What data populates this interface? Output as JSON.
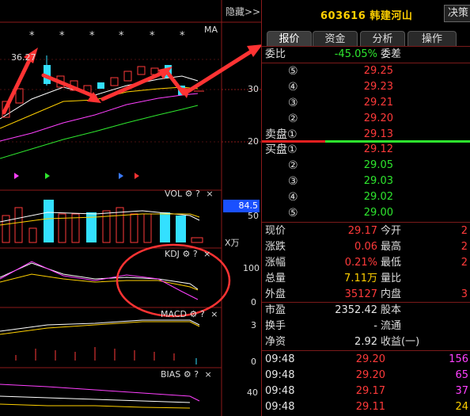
{
  "header": {
    "hide_label": "隐藏>>",
    "stock_code": "603616",
    "stock_name": "韩建河山",
    "decision_label": "决策"
  },
  "tabs": [
    "报价",
    "资金",
    "分析",
    "操作"
  ],
  "commission": {
    "label": "委比",
    "ratio": "-45.05%",
    "diff_label": "委差"
  },
  "asks": [
    {
      "num": "⑤",
      "price": "29.25"
    },
    {
      "num": "④",
      "price": "29.23"
    },
    {
      "num": "③",
      "price": "29.21"
    },
    {
      "num": "②",
      "price": "29.20"
    },
    {
      "num": "卖盘①",
      "price": "29.13"
    }
  ],
  "bids": [
    {
      "num": "买盘①",
      "price": "29.12"
    },
    {
      "num": "②",
      "price": "29.05"
    },
    {
      "num": "③",
      "price": "29.03"
    },
    {
      "num": "④",
      "price": "29.02"
    },
    {
      "num": "⑤",
      "price": "29.00"
    }
  ],
  "quote": {
    "rows": [
      {
        "l1": "现价",
        "v1": "29.17",
        "c1": "red",
        "l2": "今开",
        "v2": "2"
      },
      {
        "l1": "涨跌",
        "v1": "0.06",
        "c1": "red",
        "l2": "最高",
        "v2": "2"
      },
      {
        "l1": "涨幅",
        "v1": "0.21%",
        "c1": "red",
        "l2": "最低",
        "v2": "2"
      },
      {
        "l1": "总量",
        "v1": "7.11万",
        "c1": "yellow",
        "l2": "量比",
        "v2": ""
      },
      {
        "l1": "外盘",
        "v1": "35127",
        "c1": "red",
        "l2": "内盘",
        "v2": "3"
      }
    ]
  },
  "fundamentals": [
    {
      "l1": "市盈",
      "v1": "2352.42",
      "l2": "股本"
    },
    {
      "l1": "换手",
      "v1": "-",
      "l2": "流通"
    },
    {
      "l1": "净资",
      "v1": "2.92",
      "l2": "收益(一)"
    }
  ],
  "ticks": [
    {
      "time": "09:48",
      "price": "29.20",
      "vol": "156",
      "vc": "#ff40ff"
    },
    {
      "time": "09:48",
      "price": "29.20",
      "vol": "65",
      "vc": "#ff40ff"
    },
    {
      "time": "09:48",
      "price": "29.17",
      "vol": "37",
      "vc": "#ff40ff"
    },
    {
      "time": "09:48",
      "price": "29.11",
      "vol": "24",
      "vc": "#ffd000"
    }
  ],
  "chart": {
    "ma_label": "MA",
    "price_label": "36.27",
    "price_ticks": [
      "30",
      "20"
    ],
    "vol_panel": {
      "name": "VOL",
      "value_tag": "84.5",
      "tick": "50",
      "unit": "X万"
    },
    "kdj_panel": {
      "name": "KDJ",
      "ticks": [
        "100",
        "0"
      ]
    },
    "macd_panel": {
      "name": "MACD",
      "ticks": [
        "3",
        "0"
      ]
    },
    "bias_panel": {
      "name": "BIAS",
      "tick": "40"
    },
    "icons": {
      "gear": "gear-icon",
      "help": "?",
      "close": "×"
    }
  },
  "colors": {
    "up": "#ff3a3a",
    "down": "#2ee62e",
    "accent": "#ffd000",
    "grid": "#8b1a1a",
    "volume_cyan": "#33e0ff"
  }
}
